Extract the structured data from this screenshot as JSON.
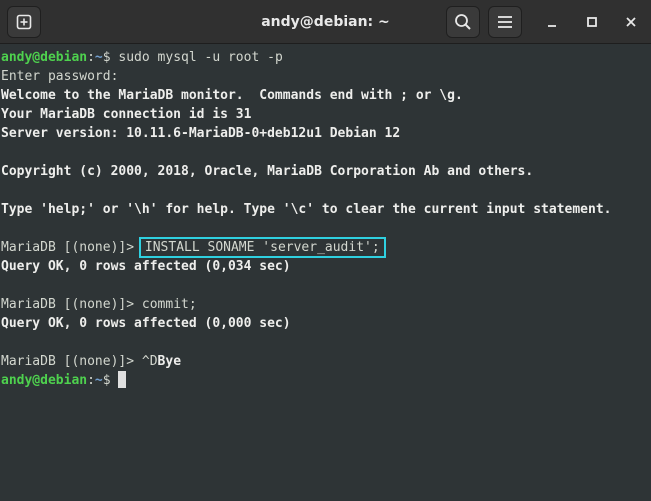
{
  "window": {
    "title": "andy@debian: ~"
  },
  "titlebar": {
    "new_tab_icon": "new-tab-icon",
    "search_icon": "search-icon",
    "menu_icon": "hamburger-menu-icon",
    "minimize_icon": "minimize-icon",
    "maximize_icon": "maximize-icon",
    "close_icon": "close-icon"
  },
  "terminal": {
    "prompt_user": "andy@debian",
    "prompt_sep": ":",
    "prompt_path": "~",
    "prompt_symbol": "$",
    "cmd1": " sudo mysql -u root -p",
    "line_password": "Enter password:",
    "line_welcome": "Welcome to the MariaDB monitor.  Commands end with ; or \\g.",
    "line_connection": "Your MariaDB connection id is 31",
    "line_version": "Server version: 10.11.6-MariaDB-0+deb12u1 Debian 12",
    "line_copyright": "Copyright (c) 2000, 2018, Oracle, MariaDB Corporation Ab and others.",
    "line_help": "Type 'help;' or '\\h' for help. Type '\\c' to clear the current input statement.",
    "mariadb_prompt": "MariaDB [(none)]> ",
    "cmd_install": "INSTALL SONAME 'server_audit';",
    "result_install": "Query OK, 0 rows affected (0,034 sec)",
    "cmd_commit": "commit;",
    "result_commit": "Query OK, 0 rows affected (0,000 sec)",
    "ctrl_d": "^D",
    "bye": "Bye"
  },
  "colors": {
    "background": "#2e3436",
    "prompt_user": "#4ed14e",
    "prompt_path": "#729fcf",
    "highlight_box": "#2fd0e0"
  }
}
